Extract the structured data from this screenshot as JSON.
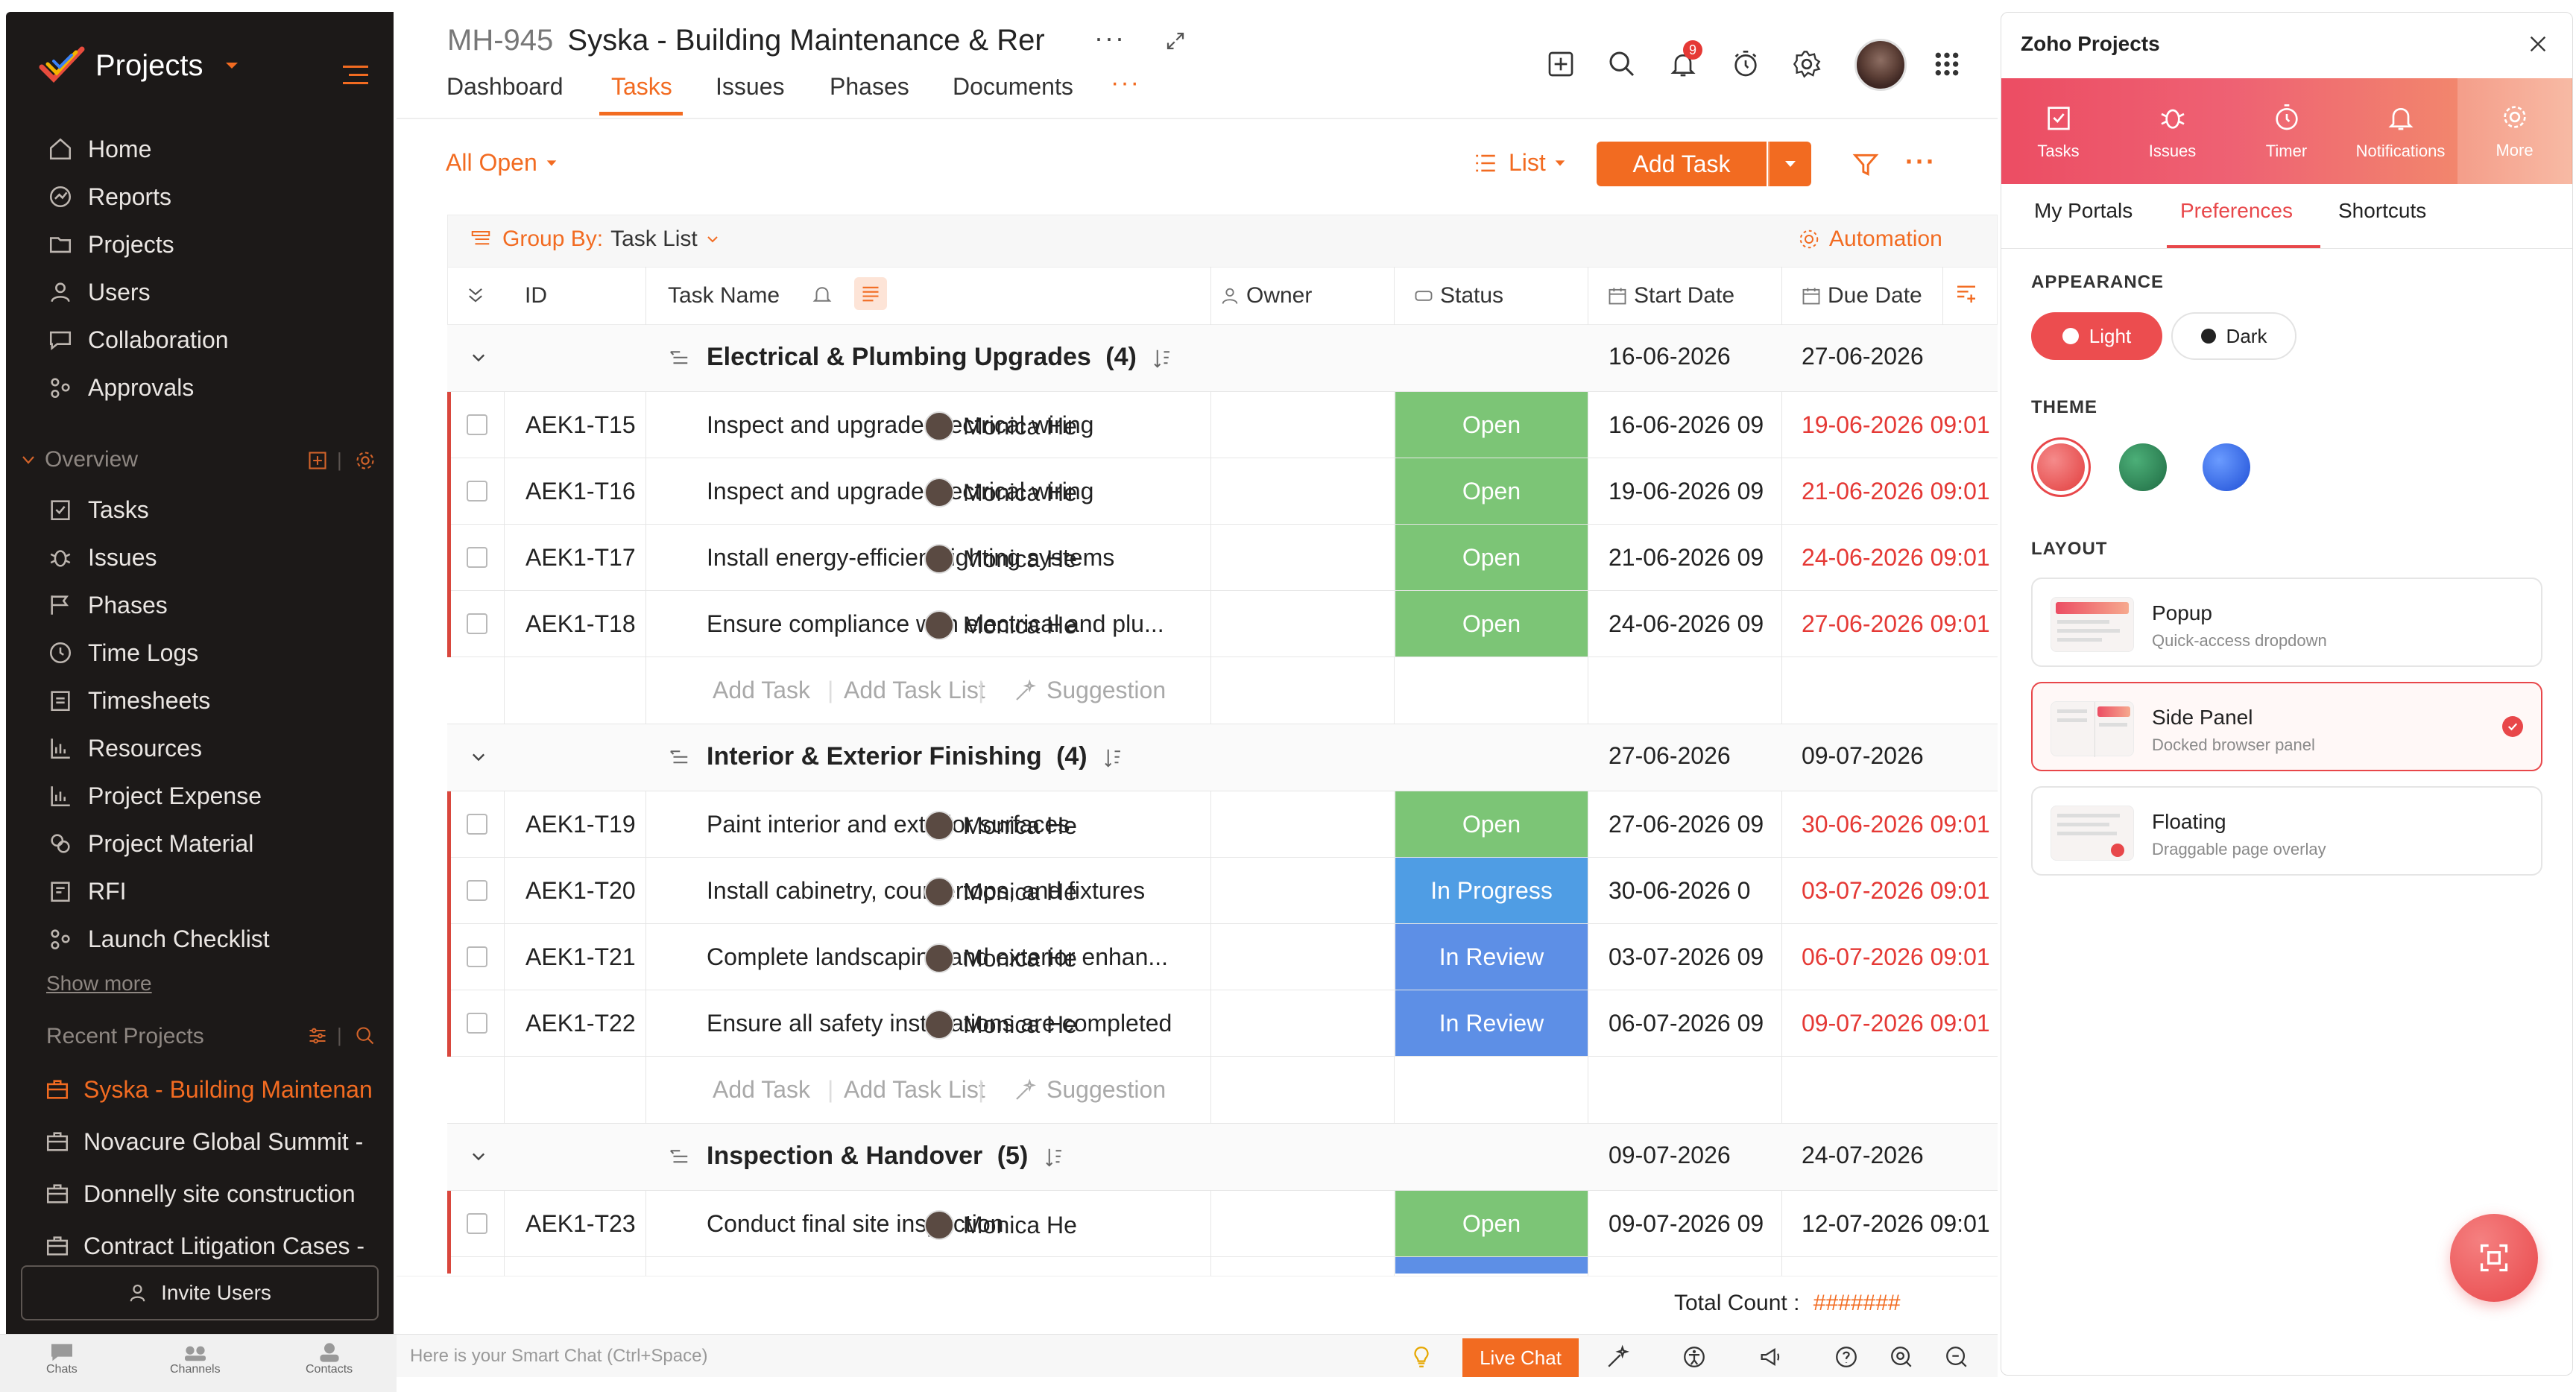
{
  "sidebar": {
    "app_title": "Projects",
    "nav": [
      "Home",
      "Reports",
      "Projects",
      "Users",
      "Collaboration",
      "Approvals"
    ],
    "overview_label": "Overview",
    "overview_items": [
      "Tasks",
      "Issues",
      "Phases",
      "Time Logs",
      "Timesheets",
      "Resources",
      "Project Expense",
      "Project Material",
      "RFI",
      "Launch Checklist"
    ],
    "show_more": "Show more",
    "recent_label": "Recent Projects",
    "recent": [
      "Syska - Building Maintenan",
      "Novacure Global Summit -",
      "Donnelly site construction",
      "Contract Litigation Cases -"
    ],
    "invite": "Invite Users",
    "bottom_tabs": [
      "Chats",
      "Channels",
      "Contacts"
    ]
  },
  "header": {
    "project_id": "MH-945",
    "project_name": "Syska - Building Maintenance & Rer",
    "tabs": [
      "Dashboard",
      "Tasks",
      "Issues",
      "Phases",
      "Documents"
    ],
    "active_tab": "Tasks",
    "notification_count": "9"
  },
  "toolbar": {
    "filter_label": "All Open",
    "view_label": "List",
    "add_task": "Add Task",
    "group_by_label": "Group By:",
    "group_by_value": "Task List",
    "automation": "Automation"
  },
  "columns": [
    "ID",
    "Task Name",
    "Owner",
    "Status",
    "Start Date",
    "Due Date"
  ],
  "groups": [
    {
      "name": "Electrical & Plumbing Upgrades",
      "count": "(4)",
      "start": "16-06-2026",
      "due": "27-06-2026",
      "rows": [
        {
          "id": "AEK1-T15",
          "name": "Inspect and upgrade electrical wiring",
          "owner": "Monica He",
          "status": "Open",
          "start": "16-06-2026 09",
          "due": "19-06-2026 09:01"
        },
        {
          "id": "AEK1-T16",
          "name": "Inspect and upgrade electrical wiring",
          "owner": "Monica He",
          "status": "Open",
          "start": "19-06-2026 09",
          "due": "21-06-2026 09:01"
        },
        {
          "id": "AEK1-T17",
          "name": "Install energy-efficient lighting systems",
          "owner": "Monica He",
          "status": "Open",
          "start": "21-06-2026 09",
          "due": "24-06-2026 09:01"
        },
        {
          "id": "AEK1-T18",
          "name": "Ensure compliance with electrical and plu...",
          "owner": "Monica He",
          "status": "Open",
          "start": "24-06-2026 09",
          "due": "27-06-2026 09:01"
        }
      ]
    },
    {
      "name": "Interior & Exterior Finishing",
      "count": "(4)",
      "start": "27-06-2026",
      "due": "09-07-2026",
      "rows": [
        {
          "id": "AEK1-T19",
          "name": "Paint interior and exterior surfaces",
          "owner": "Monica He",
          "status": "Open",
          "start": "27-06-2026 09",
          "due": "30-06-2026 09:01"
        },
        {
          "id": "AEK1-T20",
          "name": "Install cabinetry, countertops, and fixtures",
          "owner": "Monica He",
          "status": "In Progress",
          "start": "30-06-2026 0",
          "due": "03-07-2026 09:01"
        },
        {
          "id": "AEK1-T21",
          "name": "Complete landscaping and exterior enhan...",
          "owner": "Monica He",
          "status": "In Review",
          "start": "03-07-2026 09",
          "due": "06-07-2026 09:01"
        },
        {
          "id": "AEK1-T22",
          "name": "Ensure all safety installations are completed",
          "owner": "Monica He",
          "status": "In Review",
          "start": "06-07-2026 09",
          "due": "09-07-2026 09:01"
        }
      ]
    },
    {
      "name": "Inspection & Handover",
      "count": "(5)",
      "start": "09-07-2026",
      "due": "24-07-2026",
      "rows": [
        {
          "id": "AEK1-T23",
          "name": "Conduct final site inspection",
          "owner": "Monica He",
          "status": "Open",
          "start": "09-07-2026 09",
          "due": "12-07-2026 09:01"
        }
      ]
    }
  ],
  "add_row": {
    "add_task": "Add Task",
    "add_task_list": "Add Task List",
    "suggestion": "Suggestion"
  },
  "footer": {
    "total_label": "Total Count :",
    "total_value": "#######",
    "smart_chat": "Here is your Smart Chat (Ctrl+Space)",
    "live_chat": "Live Chat"
  },
  "panel": {
    "title": "Zoho Projects",
    "tabs": [
      "Tasks",
      "Issues",
      "Timer",
      "Notifications",
      "More"
    ],
    "subtabs": [
      "My Portals",
      "Preferences",
      "Shortcuts"
    ],
    "appearance_label": "APPEARANCE",
    "light": "Light",
    "dark": "Dark",
    "theme_label": "THEME",
    "layout_label": "LAYOUT",
    "layouts": [
      {
        "title": "Popup",
        "desc": "Quick-access dropdown"
      },
      {
        "title": "Side Panel",
        "desc": "Docked browser panel"
      },
      {
        "title": "Floating",
        "desc": "Draggable page overlay"
      }
    ]
  },
  "colors": {
    "accent": "#f26b21",
    "open": "#7cc576",
    "in_progress": "#4f9de4",
    "in_review": "#5d8fe6",
    "due_red": "#e53935",
    "sidebar_bg": "#1c1918"
  }
}
